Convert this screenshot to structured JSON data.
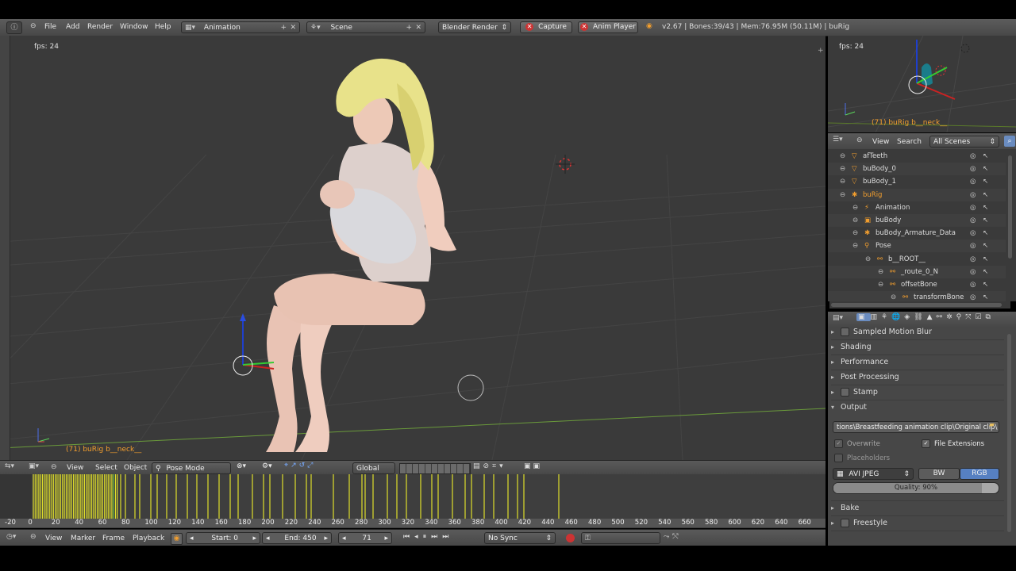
{
  "info_header": {
    "menus": [
      "File",
      "Add",
      "Render",
      "Window",
      "Help"
    ],
    "screen_layout": "Animation",
    "scene": "Scene",
    "render_engine": "Blender Render",
    "capture_label": "Capture",
    "anim_player_label": "Anim Player",
    "stats": "v2.67 | Bones:39/43 | Mem:76.95M (50.11M) | buRig"
  },
  "viewport": {
    "fps": "fps: 24",
    "object_info": "(71) buRig b__neck__",
    "left_frame_badge": "71"
  },
  "view3d_header": {
    "view": "View",
    "select": "Select",
    "object": "Object",
    "mode": "Pose Mode",
    "orientation": "Global"
  },
  "timeline": {
    "ruler": [
      "-20",
      "0",
      "20",
      "40",
      "60",
      "80",
      "100",
      "120",
      "140",
      "160",
      "180",
      "200",
      "220",
      "240",
      "260",
      "280",
      "300",
      "320",
      "340",
      "360",
      "380",
      "400",
      "420",
      "440",
      "460",
      "480",
      "500",
      "520",
      "540",
      "560",
      "580",
      "600",
      "620",
      "640",
      "660"
    ],
    "current_frame": 71
  },
  "timeline_header": {
    "view": "View",
    "marker": "Marker",
    "frame": "Frame",
    "playback": "Playback",
    "start": "Start: 0",
    "end": "End: 450",
    "current": "71",
    "sync": "No Sync"
  },
  "mini_view": {
    "fps": "fps: 24",
    "object_info": "(71) buRig b__neck__"
  },
  "outliner": {
    "view": "View",
    "search": "Search",
    "filter": "All Scenes",
    "rows": [
      {
        "label": "afTeeth",
        "indent": 0
      },
      {
        "label": "buBody_0",
        "indent": 0
      },
      {
        "label": "buBody_1",
        "indent": 0
      },
      {
        "label": "buRig",
        "indent": 0
      },
      {
        "label": "Animation",
        "indent": 1
      },
      {
        "label": "buBody",
        "indent": 1
      },
      {
        "label": "buBody_Armature_Data",
        "indent": 1
      },
      {
        "label": "Pose",
        "indent": 1
      },
      {
        "label": "b__ROOT__",
        "indent": 2
      },
      {
        "label": "_route_0_N",
        "indent": 3
      },
      {
        "label": "offsetBone",
        "indent": 3
      },
      {
        "label": "transformBone",
        "indent": 4
      }
    ]
  },
  "properties": {
    "panels": [
      {
        "label": "Sampled Motion Blur",
        "checkbox": true
      },
      {
        "label": "Shading",
        "checkbox": false
      },
      {
        "label": "Performance",
        "checkbox": false
      },
      {
        "label": "Post Processing",
        "checkbox": false
      },
      {
        "label": "Stamp",
        "checkbox": true
      },
      {
        "label": "Output",
        "checkbox": false,
        "open": true
      }
    ],
    "output_path": "tions\\Breastfeeding animation clip\\Original clip\\",
    "overwrite": "Overwrite",
    "file_extensions": "File Extensions",
    "placeholders": "Placeholders",
    "format": "AVI JPEG",
    "bw": "BW",
    "rgb": "RGB",
    "quality": "Quality: 90%",
    "bake": "Bake",
    "freestyle": "Freestyle"
  },
  "colors": {
    "selected_text": "#f29e2e",
    "keyframe": "#dede2a",
    "rgb_active": "#5680c2"
  }
}
